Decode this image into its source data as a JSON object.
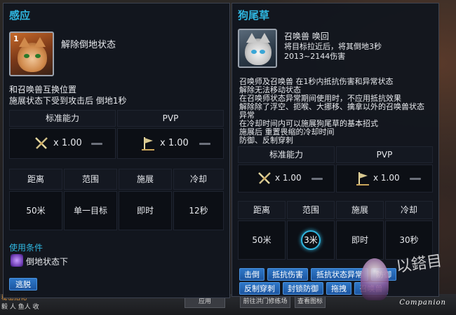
{
  "left_panel": {
    "title": "感应",
    "skill_icon_num": "1",
    "effect": "解除倒地状态",
    "desc_lines": [
      "和召唤兽互换位置",
      "施展状态下受到攻击后 倒地1秒"
    ],
    "stats_headers": [
      "标准能力",
      "PVP"
    ],
    "stats_values": [
      "x 1.00",
      "x 1.00"
    ],
    "info_headers": [
      "距离",
      "范围",
      "施展",
      "冷却"
    ],
    "info_values": [
      "50米",
      "单一目标",
      "即时",
      "12秒"
    ],
    "condition_title": "使用条件",
    "condition": "倒地状态下",
    "tag": "逃脱"
  },
  "right_panel": {
    "title": "狗尾草",
    "skill_name": "召唤兽 唤回",
    "skill_desc1": "将目标拉近后，将其倒地3秒",
    "skill_desc2": "2013~2144伤害",
    "desc_lines": [
      "召唤师及召唤兽 在1秒内抵抗伤害和异常状态",
      "解除无法移动状态",
      "在召唤师状态异常期间使用时，不应用抵抗效果",
      "解除除了浮空、扼喉、大挪移、擒拿以外的召唤兽状态",
      "异常",
      "在冷却时间内可以施展狗尾草的基本招式",
      "施展后 重置畏缩的冷却时间",
      "防御、反制穿刺"
    ],
    "stats_headers": [
      "标准能力",
      "PVP"
    ],
    "stats_values": [
      "x 1.00",
      "x 1.00"
    ],
    "info_headers": [
      "距离",
      "范围",
      "施展",
      "冷却"
    ],
    "info_values": [
      "50米",
      "3米",
      "即时",
      "30秒"
    ],
    "tags_row1": [
      "击倒",
      "抵抗伤害",
      "抵抗状态异常",
      "防御"
    ],
    "tags_row2": [
      "反制穿刺",
      "封锁防御",
      "拖拽",
      "召唤兽"
    ]
  },
  "background": {
    "bottom_buttons": [
      "应用",
      "前往洪门修练场",
      "查看图标"
    ],
    "corner_text_1": "秘密招化",
    "corner_text_2": "毅 人 鱼人 收"
  },
  "watermark": {
    "script": "以鎝目",
    "text": "Companion"
  },
  "colors": {
    "accent": "#2fb6e0",
    "tag_bg": "#1c55a0",
    "panel_bg": "#12161e"
  }
}
